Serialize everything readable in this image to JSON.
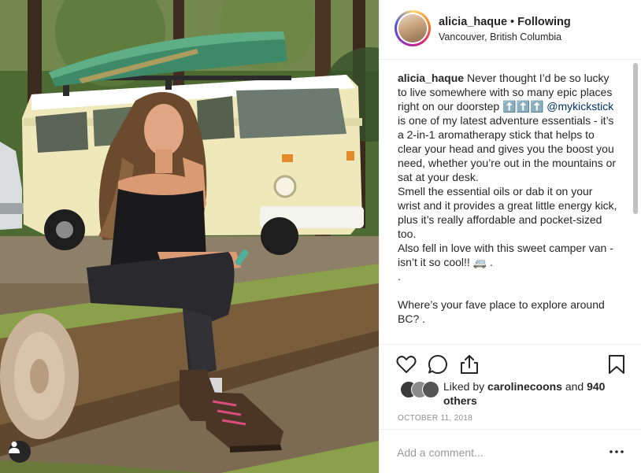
{
  "post": {
    "username": "alicia_haque",
    "separator": "•",
    "follow_status": "Following",
    "location": "Vancouver, British Columbia"
  },
  "caption": {
    "username": "alicia_haque",
    "text_1": "Never thought I’d be so lucky to live somewhere with so many epic places right on our doorstep ⬆️⬆️⬆️",
    "mention": "@mykickstick",
    "text_2": "is one of my latest adventure essentials - it’s a 2-in-1 aromatherapy stick that helps to clear your head and gives you the boost you need, whether you’re out in the mountains or sat at your desk.",
    "text_3": "Smell the essential oils or dab it on your wrist and it provides a great little energy kick, plus it’s really affordable and pocket-sized too.",
    "text_4": "Also fell in love with this sweet camper van - isn’t it so cool!! 🚐 .",
    "text_5": ".",
    "text_6": "Where’s your fave place to explore around BC? ."
  },
  "likes": {
    "prefix": "Liked by",
    "liker": "carolinecoons",
    "and": "and",
    "others": "940 others"
  },
  "date": "OCTOBER 11, 2018",
  "comment": {
    "placeholder": "Add a comment..."
  },
  "icons": {
    "like": "heart-icon",
    "comment": "comment-bubble-icon",
    "share": "share-icon",
    "save": "bookmark-icon",
    "more": "more-dots-icon",
    "user_tag": "user-tag-icon"
  },
  "colors": {
    "mention": "#003569",
    "muted": "#8e8e8e",
    "text": "#262626"
  }
}
